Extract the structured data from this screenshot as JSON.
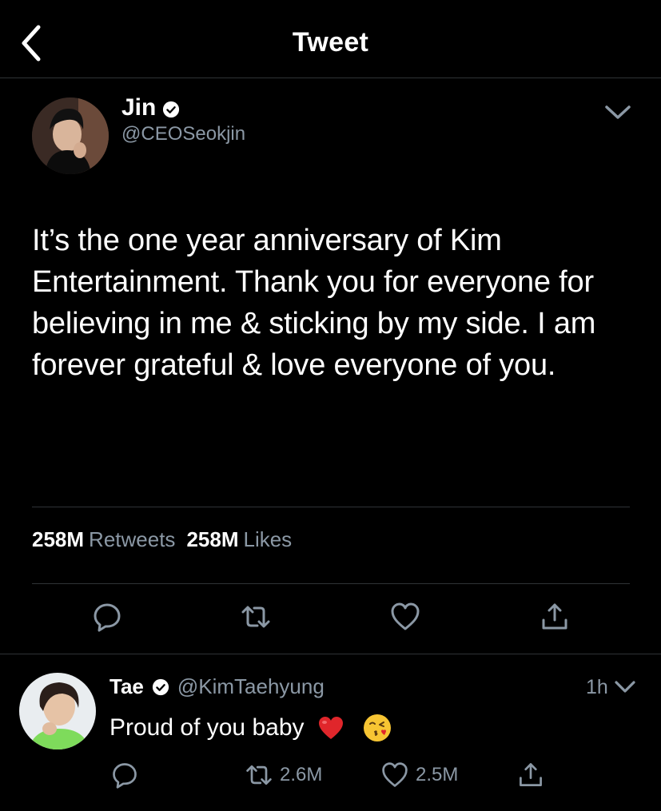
{
  "header": {
    "title": "Tweet"
  },
  "tweet": {
    "author_name": "Jin",
    "author_handle": "@CEOSeokjin",
    "text": "It’s the one year anniversary of Kim Entertainment. Thank you for everyone for believing in me & sticking by my side. I am forever grateful & love everyone of you.",
    "retweets_count": "258M",
    "retweets_label": "Retweets",
    "likes_count": "258M",
    "likes_label": "Likes"
  },
  "reply": {
    "author_name": "Tae",
    "author_handle": "@KimTaehyung",
    "time": "1h",
    "text": "Proud of you baby",
    "retweets": "2.6M",
    "likes": "2.5M"
  },
  "colors": {
    "background": "#000000",
    "secondary_text": "#8b98a5",
    "divider": "#2f3336",
    "heart_emoji": "#e0262b"
  }
}
